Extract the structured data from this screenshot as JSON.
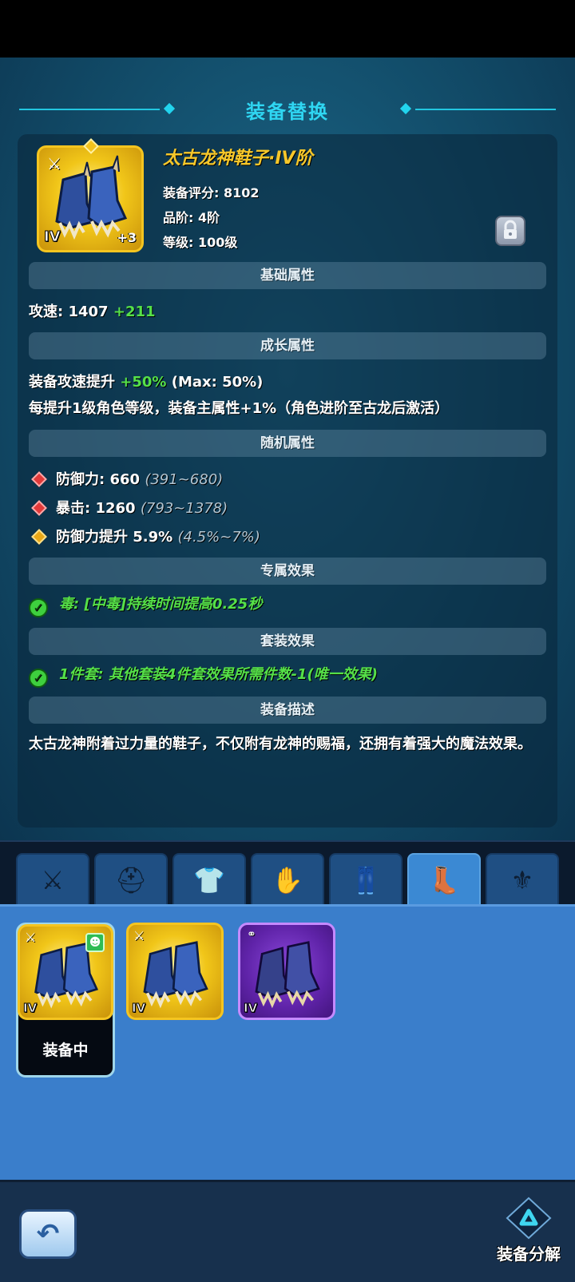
{
  "header": {
    "title": "装备替换"
  },
  "item": {
    "name": "太古龙神鞋子·IV阶",
    "tier_badge": "IV",
    "plus_badge": "+3",
    "score": "装备评分: 8102",
    "grade": "品阶: 4阶",
    "level": "等级: 100级",
    "locked": true
  },
  "sections": {
    "base": "基础属性",
    "growth": "成长属性",
    "random": "随机属性",
    "exclusive": "专属效果",
    "set": "套装效果",
    "description": "装备描述"
  },
  "base_attr": {
    "label": "攻速:",
    "value": "1407",
    "bonus": "+211"
  },
  "growth_attr": {
    "line1_label": "装备攻速提升",
    "line1_value": "+50%",
    "line1_max": "(Max: 50%)",
    "line2": "每提升1级角色等级，装备主属性+1%（角色进阶至古龙后激活）"
  },
  "random_attrs": [
    {
      "label": "防御力: 660",
      "range": "(391~680)",
      "rarity": "red"
    },
    {
      "label": "暴击: 1260",
      "range": "(793~1378)",
      "rarity": "red"
    },
    {
      "label": "防御力提升 5.9%",
      "range": "(4.5%~7%)",
      "rarity": "gold"
    }
  ],
  "exclusive_effect": "毒: [中毒]持续时间提高0.25秒",
  "set_effect": "1件套: 其他套装4件套效果所需件数-1(唯一效果)",
  "description": "太古龙神附着过力量的鞋子，不仅附有龙神的赐福，还拥有着强大的魔法效果。",
  "tabs": [
    {
      "name": "weapon",
      "icon": "sword-icon",
      "glyph": "⚔"
    },
    {
      "name": "helmet",
      "icon": "helmet-icon",
      "glyph": "⛑"
    },
    {
      "name": "armor",
      "icon": "armor-icon",
      "glyph": "👕"
    },
    {
      "name": "bracer",
      "icon": "bracer-icon",
      "glyph": "✋"
    },
    {
      "name": "pants",
      "icon": "pants-icon",
      "glyph": "👖"
    },
    {
      "name": "boots",
      "icon": "boots-icon",
      "glyph": "👢",
      "active": true
    },
    {
      "name": "accessory",
      "icon": "necklace-icon",
      "glyph": "⚜"
    }
  ],
  "inventory": [
    {
      "tier": "IV",
      "rarity": "gold",
      "equipped": true,
      "status": "装备中"
    },
    {
      "tier": "IV",
      "rarity": "gold",
      "equipped": false
    },
    {
      "tier": "IV",
      "rarity": "purple",
      "equipped": false
    }
  ],
  "footer": {
    "back_glyph": "↶",
    "salvage_label": "装备分解"
  },
  "colors": {
    "accent": "#2fd6f2",
    "gold": "#f6c72a",
    "green": "#55e048",
    "purple": "#7a3bc7"
  }
}
